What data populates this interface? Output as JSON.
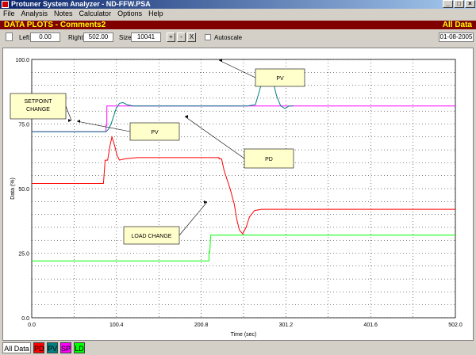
{
  "window": {
    "title": "Protuner System Analyzer - ND-FFW.PSA"
  },
  "menu": [
    "File",
    "Analysis",
    "Notes",
    "Calculator",
    "Options",
    "Help"
  ],
  "header": {
    "left": "DATA PLOTS - Comments2",
    "right": "All Data"
  },
  "toolbar": {
    "left_label": "Left",
    "left_value": "0.00",
    "right_label": "Right",
    "right_value": "502.00",
    "size_label": "Size",
    "size_value": "10041",
    "zoom_in": "+",
    "zoom_out": "-",
    "zoom_fit": "X",
    "autoscale_label": "Autoscale",
    "date": "01-08-2005"
  },
  "tabs": [
    {
      "label": "All Data",
      "color": "#ffffff"
    },
    {
      "label": "PD",
      "color": "#ff0000"
    },
    {
      "label": "PV",
      "color": "#008080"
    },
    {
      "label": "SP",
      "color": "#ff00ff"
    },
    {
      "label": "LD",
      "color": "#00ff00"
    }
  ],
  "chart_data": {
    "type": "line",
    "xlabel": "Time (sec)",
    "ylabel": "Data (%)",
    "xlim": [
      0,
      502
    ],
    "ylim": [
      0,
      100
    ],
    "x_ticks": [
      "0.0",
      "100.4",
      "200.8",
      "301.2",
      "401.6",
      "502.0"
    ],
    "y_ticks": [
      "0.0",
      "25.0",
      "50.0",
      "75.0",
      "100.0"
    ],
    "grid": true,
    "series": [
      {
        "name": "SP",
        "color": "#ff00ff",
        "points": [
          [
            0,
            72
          ],
          [
            88,
            72
          ],
          [
            88,
            74.5
          ],
          [
            89,
            74.5
          ],
          [
            89,
            82
          ],
          [
            502,
            82
          ]
        ]
      },
      {
        "name": "PV",
        "color": "#008080",
        "points": [
          [
            0,
            72
          ],
          [
            88,
            72
          ],
          [
            91,
            73
          ],
          [
            94,
            75
          ],
          [
            97,
            78
          ],
          [
            100,
            81
          ],
          [
            104,
            83
          ],
          [
            108,
            83.3
          ],
          [
            113,
            82.5
          ],
          [
            120,
            82
          ],
          [
            125,
            82
          ],
          [
            255,
            82
          ],
          [
            265,
            82.5
          ],
          [
            270,
            88
          ],
          [
            275,
            94
          ],
          [
            280,
            96
          ],
          [
            285,
            93
          ],
          [
            290,
            86
          ],
          [
            295,
            82
          ],
          [
            300,
            81
          ],
          [
            305,
            82
          ],
          [
            310,
            82
          ]
        ]
      },
      {
        "name": "PD",
        "color": "#ff0000",
        "points": [
          [
            0,
            52
          ],
          [
            85,
            52
          ],
          [
            87,
            61
          ],
          [
            90,
            61
          ],
          [
            93,
            67
          ],
          [
            95,
            70
          ],
          [
            98,
            67
          ],
          [
            101,
            63
          ],
          [
            104,
            61
          ],
          [
            110,
            61.5
          ],
          [
            125,
            62
          ],
          [
            222,
            62
          ],
          [
            222,
            61.5
          ],
          [
            225,
            61.5
          ],
          [
            228,
            57
          ],
          [
            235,
            50
          ],
          [
            240,
            44
          ],
          [
            243,
            38
          ],
          [
            246,
            34
          ],
          [
            250,
            32.5
          ],
          [
            254,
            35
          ],
          [
            258,
            39
          ],
          [
            264,
            41.5
          ],
          [
            272,
            42
          ],
          [
            502,
            42
          ]
        ]
      },
      {
        "name": "LD",
        "color": "#00ff00",
        "points": [
          [
            0,
            22
          ],
          [
            210,
            22
          ],
          [
            210,
            25.5
          ],
          [
            211,
            25.5
          ],
          [
            212,
            32
          ],
          [
            502,
            32
          ]
        ]
      }
    ],
    "annotations": [
      {
        "text": "SETPOINT CHANGE"
      },
      {
        "text": "PV"
      },
      {
        "text": "PV"
      },
      {
        "text": "PD"
      },
      {
        "text": "LOAD CHANGE"
      }
    ]
  }
}
